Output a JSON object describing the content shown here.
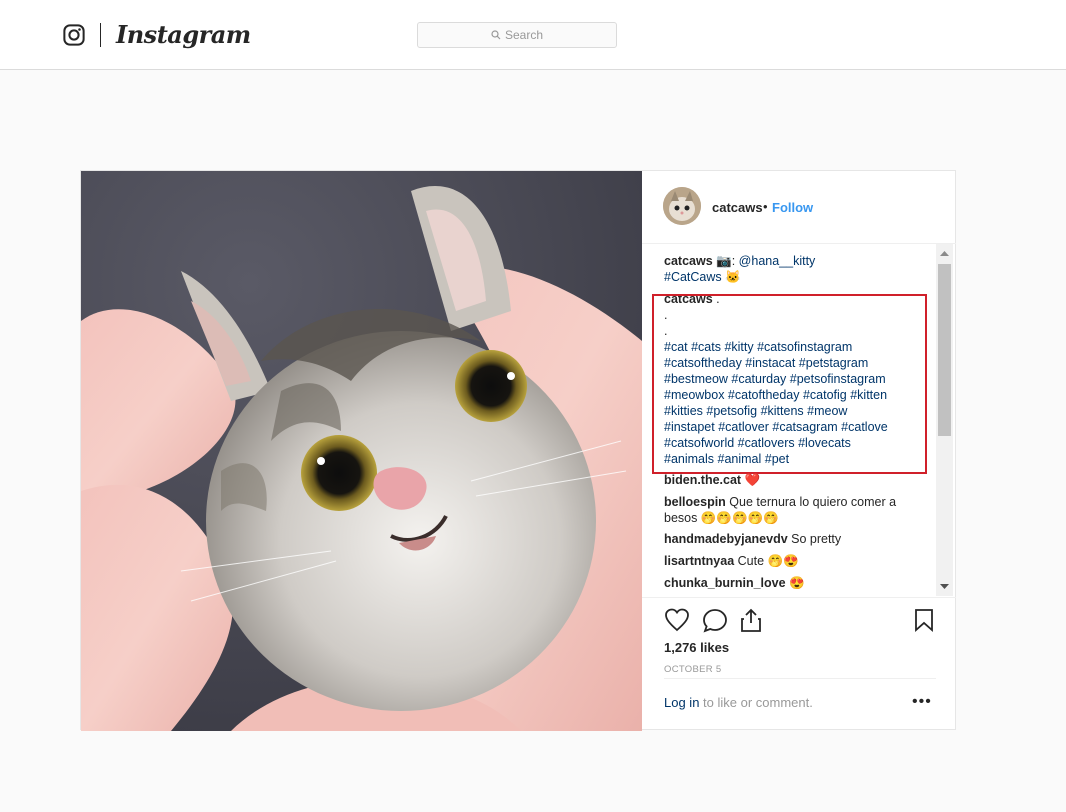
{
  "header": {
    "brand": "Instagram",
    "search_placeholder": "Search"
  },
  "post": {
    "username": "catcaws",
    "separator": "•",
    "follow_label": "Follow",
    "caption": {
      "username": "catcaws",
      "camera_emoji": "📷",
      "mention": "@hana__kitty",
      "hashtag": "#CatCaws",
      "cat_emoji": "🐱"
    },
    "highlighted_comment": {
      "username": "catcaws",
      "line1_suffix": " .",
      "line2": ".",
      "line3": ".",
      "hashtag_lines": [
        "#cat #cats #kitty #catsofinstagram",
        "#catsoftheday #instacat #petstagram",
        "#bestmeow #caturday #petsofinstagram",
        "#meowbox #catoftheday #catofig #kitten",
        "#kitties #petsofig #kittens #meow",
        "#instapet #catlover #catsagram #catlove",
        "#catsofworld #catlovers #lovecats",
        "#animals #animal #pet"
      ]
    },
    "comments": [
      {
        "user": "biden.the.cat",
        "text": " ❤️"
      },
      {
        "user": "belloespin",
        "text": " Que ternura lo quiero comer a",
        "text2": "besos 🤭🤭🤭🤭🤭"
      },
      {
        "user": "handmadebyjanevdv",
        "text": " So pretty"
      },
      {
        "user": "lisartntnyaa",
        "text": " Cute 🤭😍"
      },
      {
        "user": "chunka_burnin_love",
        "text": " 😍"
      }
    ],
    "likes": "1,276 likes",
    "date": "OCTOBER 5",
    "login_link": "Log in",
    "login_text": " to like or comment.",
    "more_label": "•••"
  }
}
